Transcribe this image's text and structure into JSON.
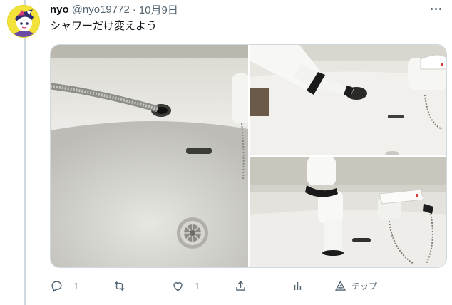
{
  "tweet": {
    "author": {
      "name": "nyo",
      "handle": "@nyo19772",
      "separator": "·",
      "date": "10月9日"
    },
    "text": "シャワーだけ変えよう",
    "media": [
      {
        "description": "sink-with-hose"
      },
      {
        "description": "shower-head-attached"
      },
      {
        "description": "faucet-installed"
      }
    ],
    "actions": {
      "reply_icon": "reply-icon",
      "reply_count": "1",
      "retweet_icon": "retweet-icon",
      "retweet_count": "",
      "like_icon": "heart-icon",
      "like_count": "1",
      "share_icon": "share-icon",
      "analytics_icon": "analytics-icon",
      "tip_icon": "tip-icon",
      "tip_label": "チップ"
    }
  },
  "colors": {
    "text_primary": "#0f1419",
    "text_secondary": "#536471",
    "border": "#cfd9de",
    "avatar_bg": "#f3e23a"
  }
}
